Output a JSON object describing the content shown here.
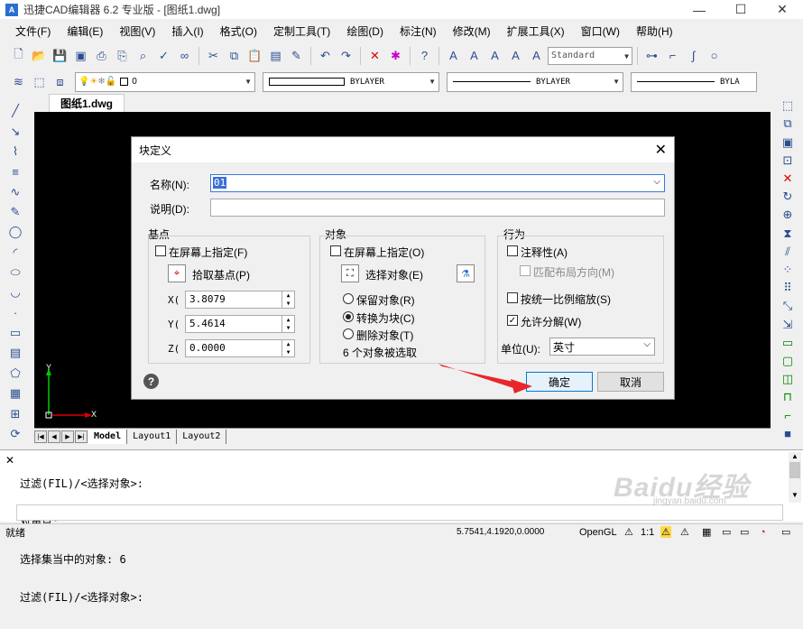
{
  "window": {
    "title": "迅捷CAD编辑器 6.2 专业版 - [图纸1.dwg]",
    "app_icon_letter": "A",
    "min": "—",
    "max": "☐",
    "close": "✕"
  },
  "menu": [
    "文件(F)",
    "编辑(E)",
    "视图(V)",
    "插入(I)",
    "格式(O)",
    "定制工具(T)",
    "绘图(D)",
    "标注(N)",
    "修改(M)",
    "扩展工具(X)",
    "窗口(W)",
    "帮助(H)"
  ],
  "toolbar": {
    "text_style": "Standard"
  },
  "layer_toolbar": {
    "layer": "0",
    "color": "BYLAYER",
    "linetype": "BYLAYER",
    "lineweight": "BYLA"
  },
  "document": {
    "tab": "图纸1.dwg"
  },
  "ucs": {
    "x_label": "X",
    "y_label": "Y"
  },
  "layout_tabs": [
    "Model",
    "Layout1",
    "Layout2"
  ],
  "command": {
    "close": "✕",
    "lines": [
      "过滤(FIL)/<选择对象>:",
      "对角点:",
      "选择集当中的对象: 6",
      "过滤(FIL)/<选择对象>:"
    ]
  },
  "watermark": {
    "main": "Baidu经验",
    "sub": "jingyan.baidu.com"
  },
  "status": {
    "ready": "就绪",
    "coords": "5.7541,4.1920,0.0000",
    "render": "OpenGL",
    "scale": "1:1"
  },
  "dialog": {
    "title": "块定义",
    "close": "✕",
    "name_label": "名称(N):",
    "name_value": "01",
    "desc_label": "说明(D):",
    "desc_value": "",
    "base": {
      "title": "基点",
      "specify_on_screen": "在屏幕上指定(F)",
      "pick_point": "拾取基点(P)",
      "x_label": "X(",
      "y_label": "Y(",
      "z_label": "Z(",
      "x": "3.8079",
      "y": "5.4614",
      "z": "0.0000"
    },
    "objects": {
      "title": "对象",
      "specify_on_screen": "在屏幕上指定(O)",
      "select_objects": "选择对象(E)",
      "retain": "保留对象(R)",
      "convert": "转换为块(C)",
      "delete": "删除对象(T)",
      "selected_count": "6 个对象被选取"
    },
    "behavior": {
      "title": "行为",
      "annotative": "注释性(A)",
      "match_orientation": "匹配布局方向(M)",
      "scale_uniformly": "按统一比例缩放(S)",
      "allow_explode": "允许分解(W)",
      "unit_label": "单位(U):",
      "unit_value": "英寸"
    },
    "ok": "确定",
    "cancel": "取消"
  }
}
